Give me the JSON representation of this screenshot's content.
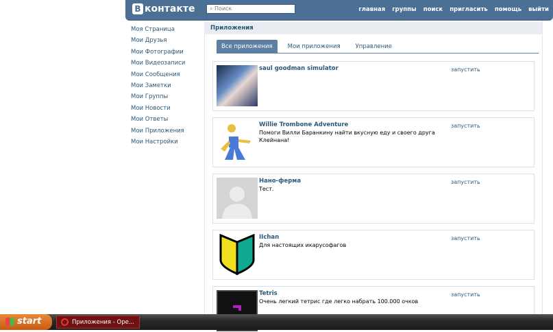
{
  "header": {
    "logo": "контакте",
    "logo_mark": "В",
    "search_placeholder": "Поиск",
    "nav": [
      "главная",
      "группы",
      "поиск",
      "пригласить",
      "помощь",
      "выйти"
    ]
  },
  "sidebar": [
    "Моя Страница",
    "Мои Друзья",
    "Мои Фотографии",
    "Мои Видеозаписи",
    "Мои Сообщения",
    "Мои Заметки",
    "Мои Группы",
    "Мои Новости",
    "Мои Ответы",
    "Мои Приложения",
    "Мои Настройки"
  ],
  "main": {
    "title": "Приложения",
    "tabs": [
      "Все приложения",
      "Мои приложения",
      "Управление"
    ],
    "apps": [
      {
        "title": "saul goodman simulator",
        "desc": "",
        "action": "запустить"
      },
      {
        "title": "Willie Trombone Adventure",
        "desc": "Помоги Вилли Баранкину найти вкусную еду и своего друга Клейнана!",
        "action": "запустить"
      },
      {
        "title": "Нано-ферма",
        "desc": "Тест.",
        "action": "запустить"
      },
      {
        "title": "IIchan",
        "desc": "Для настоящих икарусофагов",
        "action": "запустить"
      },
      {
        "title": "Tetris",
        "desc": "Очень легкий тетрис где легко набрать 100.000 очков",
        "action": "запустить"
      }
    ]
  },
  "taskbar": {
    "start": "start",
    "window": "Приложения - Ope..."
  }
}
